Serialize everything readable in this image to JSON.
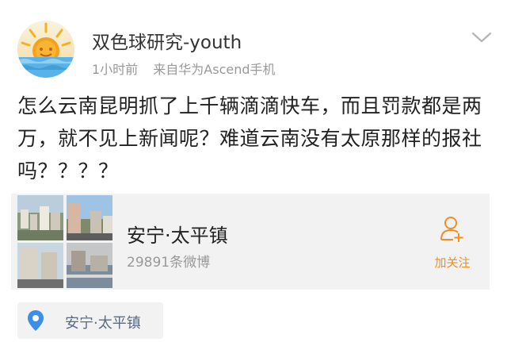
{
  "user": {
    "name": "双色球研究-youth",
    "time": "1小时前",
    "source": "来自华为Ascend手机"
  },
  "post": {
    "text": "怎么云南昆明抓了上千辆滴滴快车，而且罚款都是两万，就不见上新闻呢？难道云南没有太原那样的报社吗？？？？"
  },
  "location_card": {
    "title": "安宁·太平镇",
    "subtitle": "29891条微博",
    "follow_label": "加关注"
  },
  "location_tag": {
    "label": "安宁·太平镇"
  },
  "colors": {
    "accent_orange": "#f08e1e",
    "pin_blue": "#3b8fe8",
    "card_bg": "#f2f2f2",
    "meta_gray": "#999999"
  },
  "icons": {
    "dropdown": "chevron-down-icon",
    "follow": "add-user-icon",
    "location": "location-pin-icon"
  }
}
